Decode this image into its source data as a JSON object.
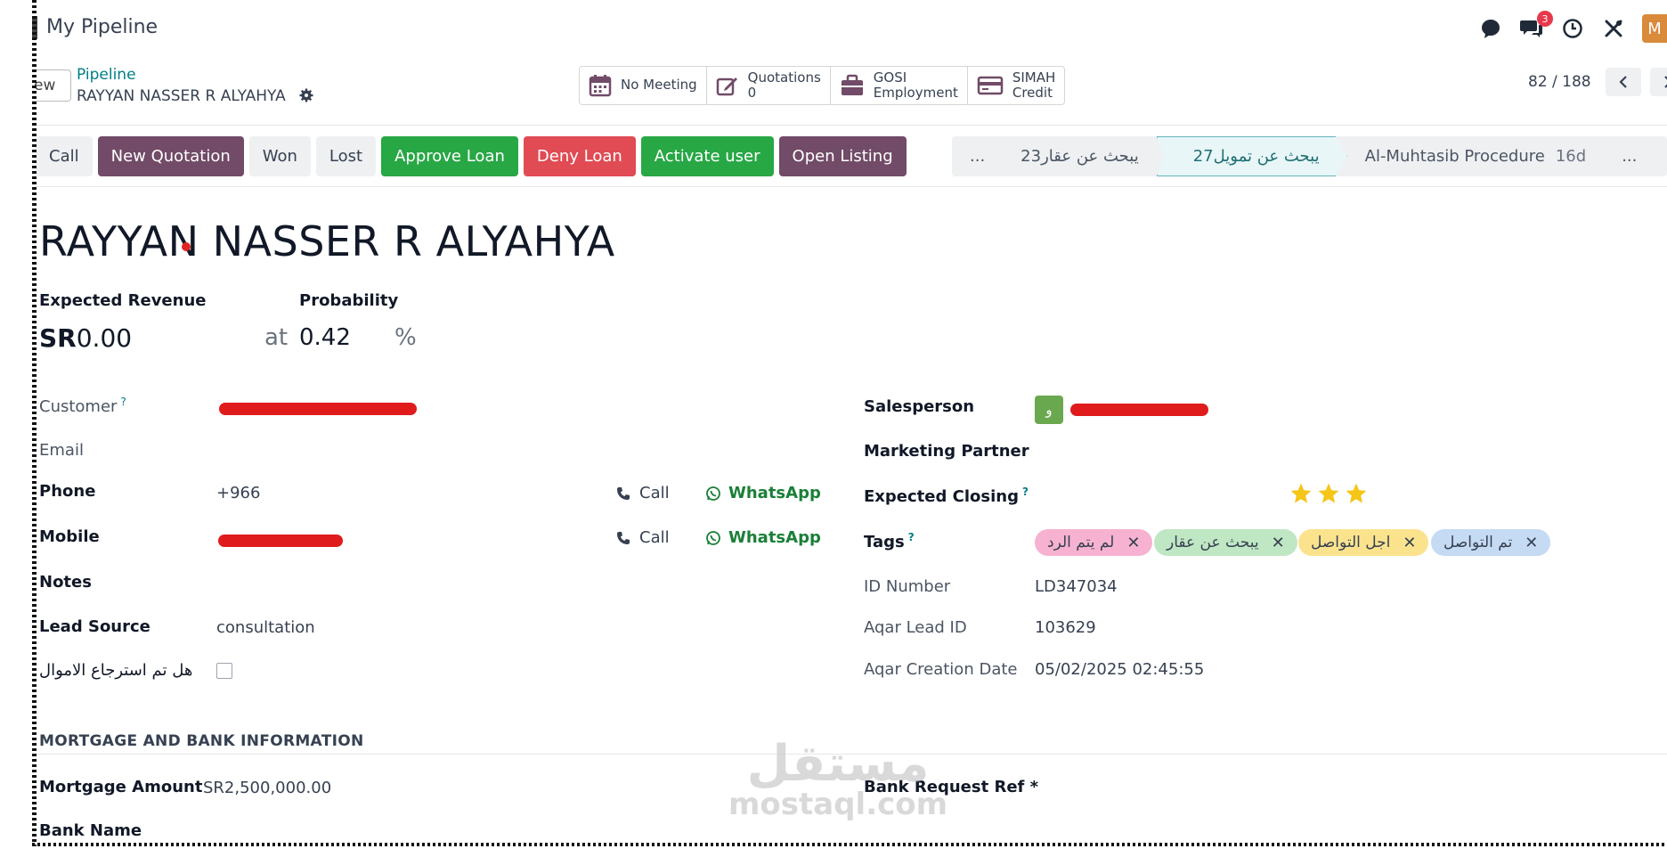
{
  "app": {
    "title": "My Pipeline",
    "user_initial": "M",
    "notification_count": "3"
  },
  "breadcrumb": {
    "new_label": "ew",
    "parent": "Pipeline",
    "current": "RAYYAN NASSER R ALYAHYA"
  },
  "smart_buttons": [
    {
      "icon": "calendar-icon",
      "label": "No Meeting",
      "sub": ""
    },
    {
      "icon": "edit-icon",
      "label": "Quotations",
      "sub": "0"
    },
    {
      "icon": "briefcase-icon",
      "label": "GOSI",
      "sub": "Employment"
    },
    {
      "icon": "credit-card-icon",
      "label": "SIMAH",
      "sub": "Credit"
    }
  ],
  "pager": {
    "value": "82 / 188"
  },
  "actions": {
    "call": "Call",
    "new_quotation": "New Quotation",
    "won": "Won",
    "lost": "Lost",
    "approve_loan": "Approve Loan",
    "deny_loan": "Deny Loan",
    "activate_user": "Activate user",
    "open_listing": "Open Listing"
  },
  "stages": {
    "more_left": "...",
    "stage1": "يبحث عن عقار",
    "stage1_count": "23",
    "stage2": "يبحث عن تمويل",
    "stage2_count": "27",
    "stage3": "Al-Muhtasib Procedure",
    "stage3_count": "16d",
    "more_right": "..."
  },
  "record": {
    "name": "RAYYAN NASSER R ALYAHYA",
    "expected_revenue_label": "Expected Revenue",
    "expected_revenue_currency": "SR",
    "expected_revenue_value": "0.00",
    "at_label": "at",
    "probability_label": "Probability",
    "probability_value": "0.42",
    "percent_sign": "%"
  },
  "left_fields": {
    "customer_label": "Customer",
    "email_label": "Email",
    "phone_label": "Phone",
    "phone_value": "+966",
    "mobile_label": "Mobile",
    "notes_label": "Notes",
    "lead_source_label": "Lead Source",
    "lead_source_value": "consultation",
    "refund_label": "هل تم استرجاع الاموال",
    "call_label": "Call",
    "whatsapp_label": "WhatsApp",
    "help_mark": "?"
  },
  "right_fields": {
    "salesperson_label": "Salesperson",
    "salesperson_avatar": "و",
    "marketing_partner_label": "Marketing Partner",
    "expected_closing_label": "Expected Closing",
    "priority_stars": 3,
    "tags_label": "Tags",
    "tags": [
      {
        "label": "لم يتم الرد",
        "color": "#f6b2d0"
      },
      {
        "label": "يبحث عن عقار",
        "color": "#bfe7c3"
      },
      {
        "label": "اجل التواصل",
        "color": "#fbe38e"
      },
      {
        "label": "تم التواصل",
        "color": "#c5daf3"
      }
    ],
    "tag_remove": "✕",
    "id_number_label": "ID Number",
    "id_number_value": "LD347034",
    "aqar_lead_id_label": "Aqar Lead ID",
    "aqar_lead_id_value": "103629",
    "aqar_creation_label": "Aqar Creation Date",
    "aqar_creation_value": "05/02/2025 02:45:55"
  },
  "mortgage": {
    "section_title": "MORTGAGE AND BANK INFORMATION",
    "amount_label": "Mortgage Amount",
    "amount_value": "SR2,500,000.00",
    "bank_name_label": "Bank Name",
    "bank_request_label": "Bank Request Ref *"
  },
  "watermark": {
    "arabic": "مستقل",
    "latin": "mostaql.com"
  },
  "colors": {
    "brand": "#714b67",
    "accent": "#017e84",
    "success": "#28a745",
    "danger": "#e04b54",
    "star": "#f5c518"
  }
}
